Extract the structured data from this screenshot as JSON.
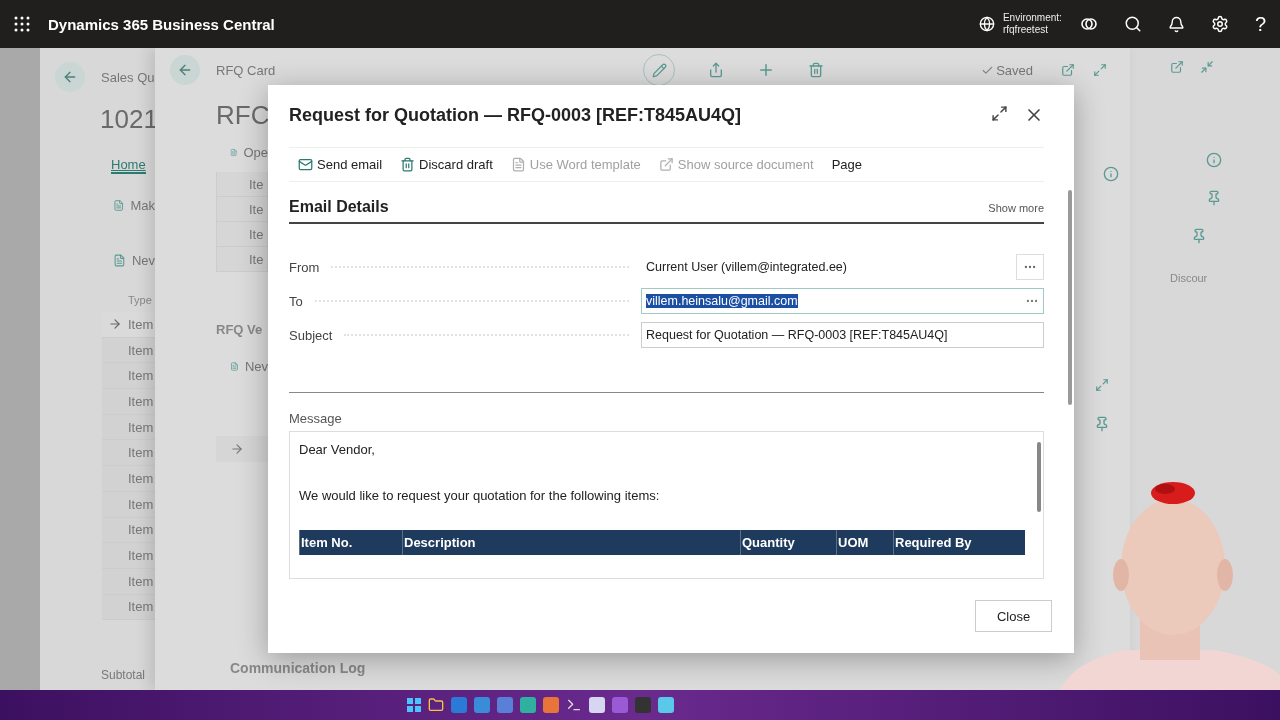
{
  "top_bar": {
    "app_title": "Dynamics 365 Business Central",
    "environment_label": "Environment:",
    "environment_name": "rfqfreetest",
    "help": "?"
  },
  "back_page": {
    "breadcrumb": "Sales Qu",
    "number": "1021",
    "tabs": [
      {
        "label": "Home",
        "selected": true
      }
    ],
    "actions": [
      "Mak",
      "Nev"
    ],
    "column": "Type",
    "rows": [
      {
        "type": "Item",
        "current": true
      },
      {
        "type": "Item",
        "current": false
      },
      {
        "type": "Item",
        "current": false
      },
      {
        "type": "Item",
        "current": false
      },
      {
        "type": "Item",
        "current": false
      },
      {
        "type": "Item",
        "current": false
      },
      {
        "type": "Item",
        "current": false
      },
      {
        "type": "Item",
        "current": false
      },
      {
        "type": "Item",
        "current": false
      },
      {
        "type": "Item",
        "current": false
      },
      {
        "type": "Item",
        "current": false
      },
      {
        "type": "Item",
        "current": false
      }
    ],
    "column_right": "Discour",
    "footer": "Subtotal"
  },
  "front_page": {
    "breadcrumb": "RFQ Card",
    "title": "RFC",
    "status": "Saved",
    "action": "Ope",
    "lines": [
      "Ite",
      "Ite",
      "Ite",
      "Ite"
    ],
    "section": "RFQ Ve",
    "section_action": "Nev",
    "log_title": "Communication Log"
  },
  "dialog": {
    "title": "Request for Quotation — RFQ-0003 [REF:T845AU4Q]",
    "toolbar": [
      {
        "kind": "send",
        "label": "Send email",
        "disabled": false
      },
      {
        "kind": "discard",
        "label": "Discard draft",
        "disabled": false
      },
      {
        "kind": "template",
        "label": "Use Word template",
        "disabled": true
      },
      {
        "kind": "source",
        "label": "Show source document",
        "disabled": true
      },
      {
        "kind": "menu",
        "label": "Page",
        "disabled": false
      }
    ],
    "section": "Email Details",
    "show_more": "Show more",
    "fields": [
      {
        "kind": "readonly",
        "label": "From",
        "value": "Current User (villem@integrated.ee)"
      },
      {
        "kind": "lookup",
        "label": "To",
        "value": "villem.heinsalu@gmail.com",
        "highlighted": true
      },
      {
        "kind": "text",
        "label": "Subject",
        "value": "Request for Quotation — RFQ-0003 [REF:T845AU4Q]"
      }
    ],
    "message_label": "Message",
    "message": [
      {
        "kind": "paragraph",
        "text": "Dear Vendor,"
      },
      {
        "kind": "paragraph",
        "text": "We would like to request your quotation for the following items:"
      },
      {
        "kind": "table",
        "columns": [
          "Item No.",
          "Description",
          "Quantity",
          "UOM",
          "Required By"
        ]
      }
    ],
    "close_button": "Close"
  }
}
